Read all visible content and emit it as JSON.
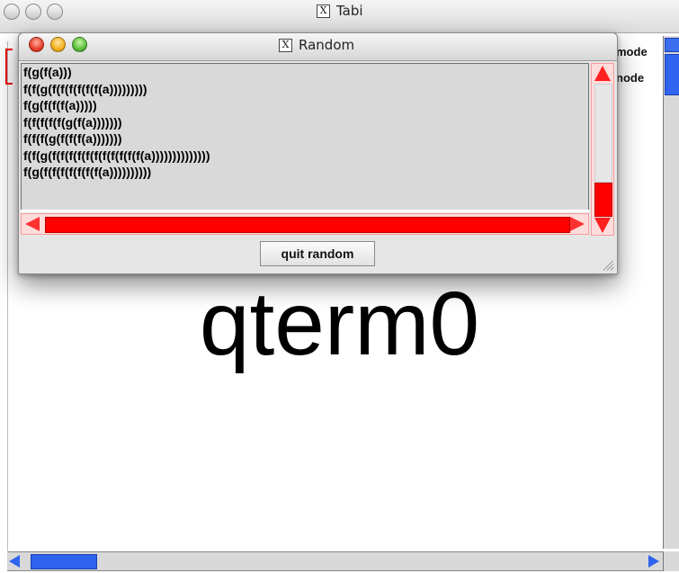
{
  "tabi_window": {
    "title": "Tabi",
    "title_icon": "x11-icon",
    "mode_labels": [
      "mode",
      "node"
    ],
    "canvas_text": "qterm0"
  },
  "random_window": {
    "title": "Random",
    "title_icon": "x11-icon",
    "lines": [
      "f(g(f(a)))",
      "f(f(g(f(f(f(f(f(f(a)))))))))",
      "f(g(f(f(f(a)))))",
      "f(f(f(f(f(g(f(a)))))))",
      "f(f(f(g(f(f(f(a)))))))",
      "f(f(g(f(f(f(f(f(f(f(f(f(f(f(a))))))))))))))",
      "f(g(f(f(f(f(f(f(f(a))))))))))"
    ],
    "quit_label": "quit random"
  },
  "colors": {
    "scroll_red": "#ff0000",
    "scroll_blue": "#2f63f0",
    "window_gray": "#e6e6e6"
  }
}
